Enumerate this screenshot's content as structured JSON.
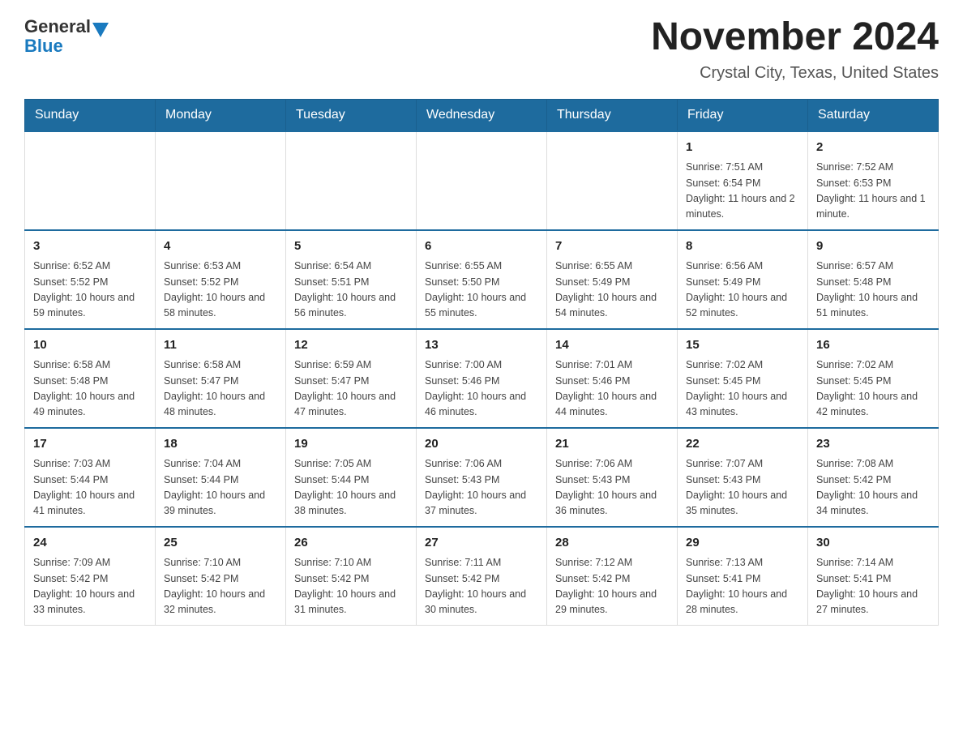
{
  "header": {
    "logo_general": "General",
    "logo_blue": "Blue",
    "title": "November 2024",
    "subtitle": "Crystal City, Texas, United States"
  },
  "columns": [
    "Sunday",
    "Monday",
    "Tuesday",
    "Wednesday",
    "Thursday",
    "Friday",
    "Saturday"
  ],
  "weeks": [
    [
      {
        "day": "",
        "info": ""
      },
      {
        "day": "",
        "info": ""
      },
      {
        "day": "",
        "info": ""
      },
      {
        "day": "",
        "info": ""
      },
      {
        "day": "",
        "info": ""
      },
      {
        "day": "1",
        "info": "Sunrise: 7:51 AM\nSunset: 6:54 PM\nDaylight: 11 hours and 2 minutes."
      },
      {
        "day": "2",
        "info": "Sunrise: 7:52 AM\nSunset: 6:53 PM\nDaylight: 11 hours and 1 minute."
      }
    ],
    [
      {
        "day": "3",
        "info": "Sunrise: 6:52 AM\nSunset: 5:52 PM\nDaylight: 10 hours and 59 minutes."
      },
      {
        "day": "4",
        "info": "Sunrise: 6:53 AM\nSunset: 5:52 PM\nDaylight: 10 hours and 58 minutes."
      },
      {
        "day": "5",
        "info": "Sunrise: 6:54 AM\nSunset: 5:51 PM\nDaylight: 10 hours and 56 minutes."
      },
      {
        "day": "6",
        "info": "Sunrise: 6:55 AM\nSunset: 5:50 PM\nDaylight: 10 hours and 55 minutes."
      },
      {
        "day": "7",
        "info": "Sunrise: 6:55 AM\nSunset: 5:49 PM\nDaylight: 10 hours and 54 minutes."
      },
      {
        "day": "8",
        "info": "Sunrise: 6:56 AM\nSunset: 5:49 PM\nDaylight: 10 hours and 52 minutes."
      },
      {
        "day": "9",
        "info": "Sunrise: 6:57 AM\nSunset: 5:48 PM\nDaylight: 10 hours and 51 minutes."
      }
    ],
    [
      {
        "day": "10",
        "info": "Sunrise: 6:58 AM\nSunset: 5:48 PM\nDaylight: 10 hours and 49 minutes."
      },
      {
        "day": "11",
        "info": "Sunrise: 6:58 AM\nSunset: 5:47 PM\nDaylight: 10 hours and 48 minutes."
      },
      {
        "day": "12",
        "info": "Sunrise: 6:59 AM\nSunset: 5:47 PM\nDaylight: 10 hours and 47 minutes."
      },
      {
        "day": "13",
        "info": "Sunrise: 7:00 AM\nSunset: 5:46 PM\nDaylight: 10 hours and 46 minutes."
      },
      {
        "day": "14",
        "info": "Sunrise: 7:01 AM\nSunset: 5:46 PM\nDaylight: 10 hours and 44 minutes."
      },
      {
        "day": "15",
        "info": "Sunrise: 7:02 AM\nSunset: 5:45 PM\nDaylight: 10 hours and 43 minutes."
      },
      {
        "day": "16",
        "info": "Sunrise: 7:02 AM\nSunset: 5:45 PM\nDaylight: 10 hours and 42 minutes."
      }
    ],
    [
      {
        "day": "17",
        "info": "Sunrise: 7:03 AM\nSunset: 5:44 PM\nDaylight: 10 hours and 41 minutes."
      },
      {
        "day": "18",
        "info": "Sunrise: 7:04 AM\nSunset: 5:44 PM\nDaylight: 10 hours and 39 minutes."
      },
      {
        "day": "19",
        "info": "Sunrise: 7:05 AM\nSunset: 5:44 PM\nDaylight: 10 hours and 38 minutes."
      },
      {
        "day": "20",
        "info": "Sunrise: 7:06 AM\nSunset: 5:43 PM\nDaylight: 10 hours and 37 minutes."
      },
      {
        "day": "21",
        "info": "Sunrise: 7:06 AM\nSunset: 5:43 PM\nDaylight: 10 hours and 36 minutes."
      },
      {
        "day": "22",
        "info": "Sunrise: 7:07 AM\nSunset: 5:43 PM\nDaylight: 10 hours and 35 minutes."
      },
      {
        "day": "23",
        "info": "Sunrise: 7:08 AM\nSunset: 5:42 PM\nDaylight: 10 hours and 34 minutes."
      }
    ],
    [
      {
        "day": "24",
        "info": "Sunrise: 7:09 AM\nSunset: 5:42 PM\nDaylight: 10 hours and 33 minutes."
      },
      {
        "day": "25",
        "info": "Sunrise: 7:10 AM\nSunset: 5:42 PM\nDaylight: 10 hours and 32 minutes."
      },
      {
        "day": "26",
        "info": "Sunrise: 7:10 AM\nSunset: 5:42 PM\nDaylight: 10 hours and 31 minutes."
      },
      {
        "day": "27",
        "info": "Sunrise: 7:11 AM\nSunset: 5:42 PM\nDaylight: 10 hours and 30 minutes."
      },
      {
        "day": "28",
        "info": "Sunrise: 7:12 AM\nSunset: 5:42 PM\nDaylight: 10 hours and 29 minutes."
      },
      {
        "day": "29",
        "info": "Sunrise: 7:13 AM\nSunset: 5:41 PM\nDaylight: 10 hours and 28 minutes."
      },
      {
        "day": "30",
        "info": "Sunrise: 7:14 AM\nSunset: 5:41 PM\nDaylight: 10 hours and 27 minutes."
      }
    ]
  ]
}
